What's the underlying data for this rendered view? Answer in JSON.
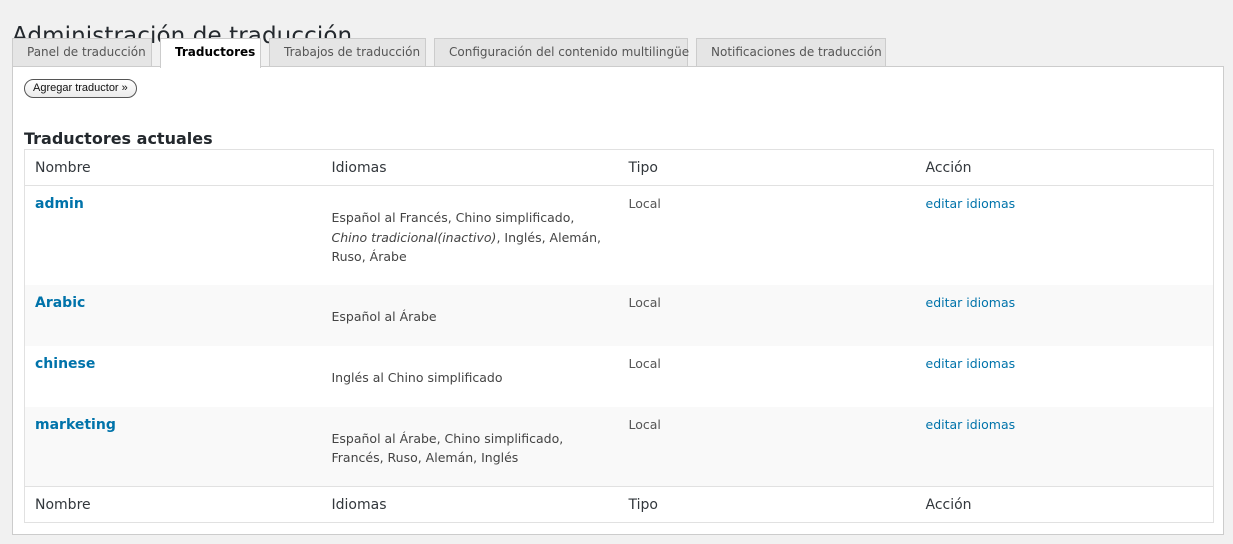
{
  "header": {
    "title": "Administración de traducción"
  },
  "tabs": [
    {
      "label": "Panel de traducción"
    },
    {
      "label": "Traductores"
    },
    {
      "label": "Trabajos de traducción"
    },
    {
      "label": "Configuración del contenido multilingüe"
    },
    {
      "label": "Notificaciones de traducción"
    }
  ],
  "active_tab": "Traductores",
  "toolbar": {
    "add_translator_label": "Agregar traductor »"
  },
  "section": {
    "title": "Traductores actuales"
  },
  "table": {
    "columns": [
      "Nombre",
      "Idiomas",
      "Tipo",
      "Acción"
    ],
    "rows": [
      {
        "name": "admin",
        "languages_pre": "Español al Francés, Chino simplificado, ",
        "languages_inactive": "Chino tradicional(inactivo)",
        "languages_post": ", Inglés, Alemán, Ruso, Árabe",
        "type": "Local",
        "action": "editar idiomas"
      },
      {
        "name": "Arabic",
        "languages": "Español al Árabe",
        "type": "Local",
        "action": "editar idiomas"
      },
      {
        "name": "chinese",
        "languages": "Inglés al Chino simplificado",
        "type": "Local",
        "action": "editar idiomas"
      },
      {
        "name": "marketing",
        "languages": "Español al Árabe, Chino simplificado, Francés, Ruso, Alemán, Inglés",
        "type": "Local",
        "action": "editar idiomas"
      }
    ]
  }
}
